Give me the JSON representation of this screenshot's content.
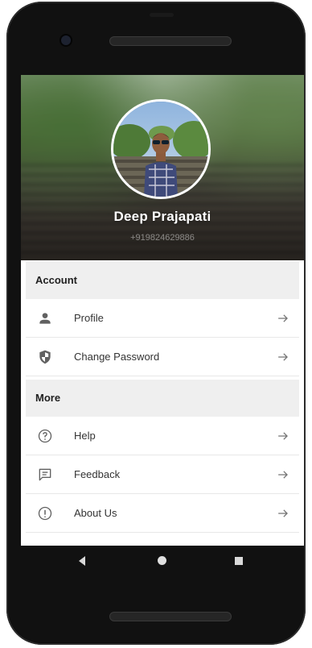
{
  "profile": {
    "name": "Deep Prajapati",
    "phone": "+919824629886"
  },
  "sections": [
    {
      "title": "Account",
      "items": [
        {
          "label": "Profile",
          "icon": "person-icon"
        },
        {
          "label": "Change Password",
          "icon": "shield-icon"
        }
      ]
    },
    {
      "title": "More",
      "items": [
        {
          "label": "Help",
          "icon": "help-circle-icon"
        },
        {
          "label": "Feedback",
          "icon": "feedback-icon"
        },
        {
          "label": "About Us",
          "icon": "info-icon"
        }
      ]
    }
  ],
  "arrow_icon": "arrow-right-icon",
  "navbar": {
    "back_icon": "back-triangle-icon",
    "home_icon": "home-circle-icon",
    "recents_icon": "recents-square-icon"
  },
  "colors": {
    "section_bg": "#efefef",
    "text": "#333333",
    "icon": "#616161"
  }
}
